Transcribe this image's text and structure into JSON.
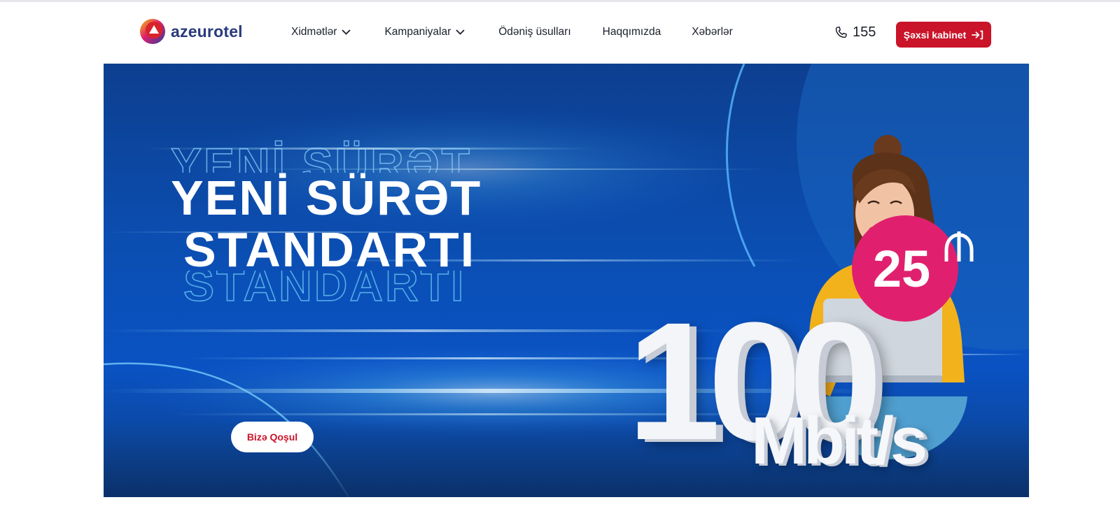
{
  "brand": {
    "name": "azeurotel",
    "colors": {
      "primary": "#2a3a7c",
      "accent_red": "#c9142a",
      "accent_pink": "#e0206e",
      "hero_blue": "#0b4fb4"
    }
  },
  "nav": {
    "items": [
      {
        "label": "Xidmətlər",
        "has_dropdown": true
      },
      {
        "label": "Kampaniyalar",
        "has_dropdown": true
      },
      {
        "label": "Ödəniş üsulları",
        "has_dropdown": false
      },
      {
        "label": "Haqqımızda",
        "has_dropdown": false
      },
      {
        "label": "Xəbərlər",
        "has_dropdown": false
      }
    ],
    "phone": {
      "number": "155",
      "icon": "phone-icon"
    },
    "cabinet": {
      "label": "Şəxsi kabinet",
      "icon": "login-arrow-icon"
    }
  },
  "hero": {
    "title_line1": "YENİ SÜRƏT",
    "title_line2": "STANDARTI",
    "cta_label": "Bizə Qoşul",
    "speed_value": "100",
    "speed_unit": "Mbit/s",
    "price_value": "25",
    "currency_icon": "manat-icon"
  }
}
